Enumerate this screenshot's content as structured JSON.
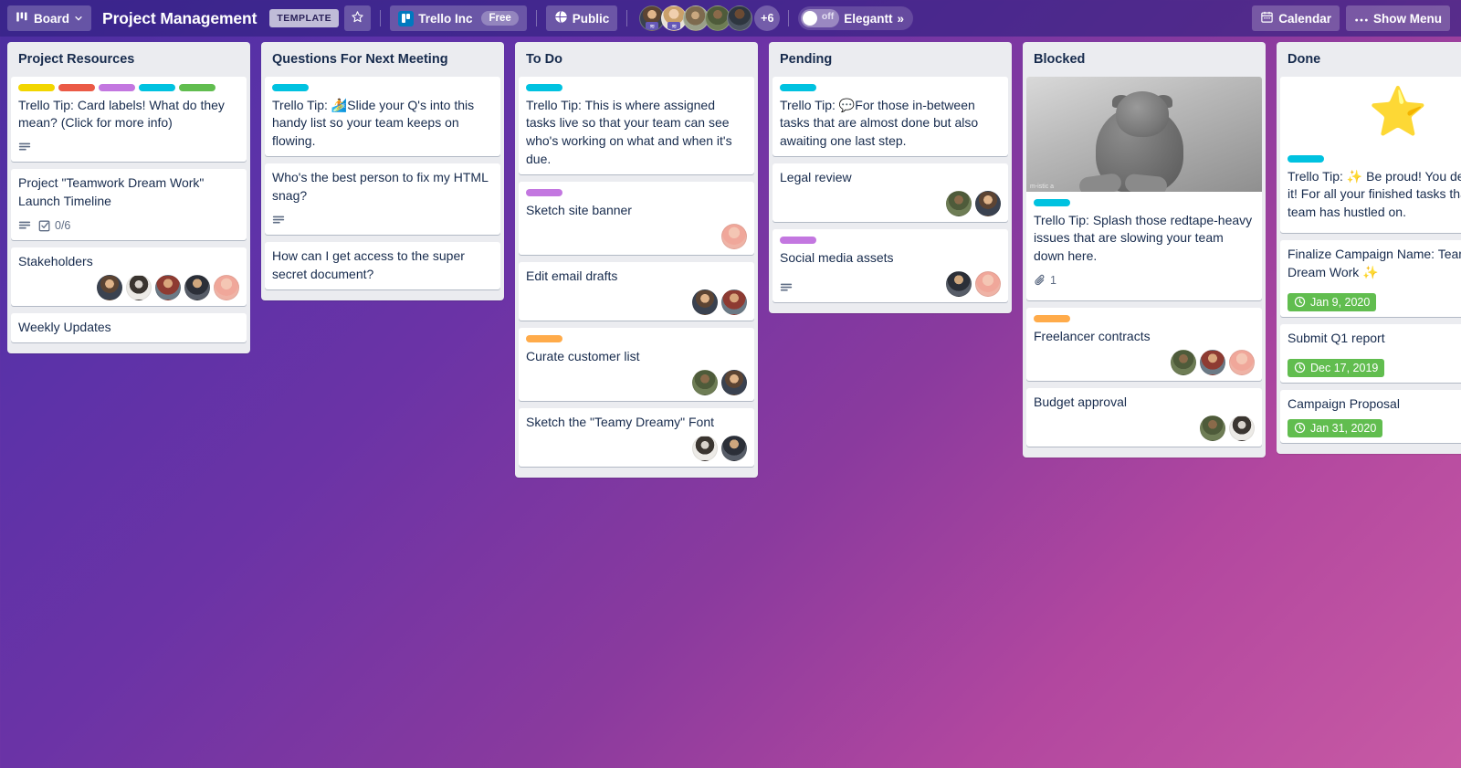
{
  "header": {
    "board_button": "Board",
    "board_icon": "board-icon",
    "chevron_icon": "chevron-down-icon",
    "title": "Project Management",
    "template_badge": "TEMPLATE",
    "star_icon": "star-outline-icon",
    "team_name": "Trello Inc",
    "team_plan": "Free",
    "visibility": "Public",
    "visibility_icon": "globe-icon",
    "members_overflow": "+6",
    "toggle_state": "off",
    "elegantt_label": "Elegantt",
    "elegantt_chevrons": "»",
    "calendar_button": "Calendar",
    "calendar_icon": "calendar-icon",
    "menu_button": "Show Menu",
    "menu_icon": "ellipsis-icon"
  },
  "colors": {
    "label_yellow": "#f2d600",
    "label_red": "#eb5a46",
    "label_purple": "#c377e0",
    "label_blue": "#00c2e0",
    "label_green": "#61bd4f",
    "label_orange": "#ffab4a",
    "due_green": "#61bd4f",
    "list_bg": "#ebecf0",
    "card_bg": "#ffffff",
    "text": "#172b4d",
    "header_bg": "#2f2080"
  },
  "lists": [
    {
      "title": "Project Resources",
      "cards": [
        {
          "labels": [
            "#f2d600",
            "#eb5a46",
            "#c377e0",
            "#00c2e0",
            "#61bd4f"
          ],
          "title": "Trello Tip: Card labels! What do they mean? (Click for more info)",
          "has_description": true,
          "members": []
        },
        {
          "labels": [],
          "title": "Project \"Teamwork Dream Work\" Launch Timeline",
          "has_description": true,
          "checklist": "0/6",
          "members": []
        },
        {
          "labels": [],
          "title": "Stakeholders",
          "members": [
            "p1",
            "p7",
            "p8",
            "p9",
            "p10"
          ]
        },
        {
          "labels": [],
          "title": "Weekly Updates",
          "members": []
        }
      ]
    },
    {
      "title": "Questions For Next Meeting",
      "cards": [
        {
          "labels": [
            "#00c2e0"
          ],
          "title": "Trello Tip: 🏄Slide your Q's into this handy list so your team keeps on flowing.",
          "members": []
        },
        {
          "labels": [],
          "title": "Who's the best person to fix my HTML snag?",
          "has_description": true,
          "members": []
        },
        {
          "labels": [],
          "title": "How can I get access to the super secret document?",
          "members": []
        }
      ]
    },
    {
      "title": "To Do",
      "cards": [
        {
          "labels": [
            "#00c2e0"
          ],
          "title": "Trello Tip: This is where assigned tasks live so that your team can see who's working on what and when it's due.",
          "members": []
        },
        {
          "labels": [
            "#c377e0"
          ],
          "title": "Sketch site banner",
          "members": [
            "p10"
          ]
        },
        {
          "labels": [],
          "title": "Edit email drafts",
          "members": [
            "p1",
            "p8"
          ]
        },
        {
          "labels": [
            "#ffab4a"
          ],
          "title": "Curate customer list",
          "members": [
            "p4",
            "p1"
          ]
        },
        {
          "labels": [],
          "title": "Sketch the \"Teamy Dreamy\" Font",
          "members": [
            "p7",
            "p9"
          ]
        }
      ]
    },
    {
      "title": "Pending",
      "cards": [
        {
          "labels": [
            "#00c2e0"
          ],
          "title": "Trello Tip: 💬For those in-between tasks that are almost done but also awaiting one last step.",
          "members": []
        },
        {
          "labels": [],
          "title": "Legal review",
          "members": [
            "p4",
            "p1"
          ]
        },
        {
          "labels": [
            "#c377e0"
          ],
          "title": "Social media assets",
          "has_description": true,
          "members": [
            "p9",
            "p10"
          ]
        }
      ]
    },
    {
      "title": "Blocked",
      "cards": [
        {
          "cover": "cat-photo",
          "cover_credit": "m-istic a",
          "labels": [
            "#00c2e0"
          ],
          "title": "Trello Tip: Splash those redtape-heavy issues that are slowing your team down here.",
          "attachments": "1",
          "members": []
        },
        {
          "labels": [
            "#ffab4a"
          ],
          "title": "Freelancer contracts",
          "members": [
            "p4",
            "p8",
            "p10"
          ]
        },
        {
          "labels": [],
          "title": "Budget approval",
          "members": [
            "p4",
            "p7"
          ]
        }
      ]
    },
    {
      "title": "Done",
      "cards": [
        {
          "cover": "star-emoji",
          "star_glyph": "⭐",
          "labels": [
            "#00c2e0"
          ],
          "title": "Trello Tip: ✨ Be proud! You deserve it! For all your finished tasks that your team has hustled on.",
          "members": []
        },
        {
          "labels": [],
          "title": "Finalize Campaign Name: Teamwork Dream Work ✨",
          "due": "Jan 9, 2020",
          "members": [
            "p4"
          ]
        },
        {
          "labels": [],
          "title": "Submit Q1 report",
          "due": "Dec 17, 2019",
          "members": [
            "p4"
          ]
        },
        {
          "labels": [],
          "title": "Campaign Proposal",
          "due": "Jan 31, 2020",
          "members": []
        }
      ]
    }
  ]
}
